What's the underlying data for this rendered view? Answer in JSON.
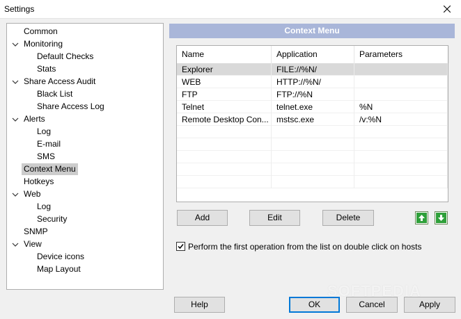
{
  "window": {
    "title": "Settings"
  },
  "tree": {
    "items": [
      {
        "label": "Common",
        "level": 0,
        "expanded": null,
        "selected": false
      },
      {
        "label": "Monitoring",
        "level": 0,
        "expanded": true,
        "selected": false
      },
      {
        "label": "Default Checks",
        "level": 1,
        "expanded": null,
        "selected": false
      },
      {
        "label": "Stats",
        "level": 1,
        "expanded": null,
        "selected": false
      },
      {
        "label": "Share Access Audit",
        "level": 0,
        "expanded": true,
        "selected": false
      },
      {
        "label": "Black List",
        "level": 1,
        "expanded": null,
        "selected": false
      },
      {
        "label": "Share Access Log",
        "level": 1,
        "expanded": null,
        "selected": false
      },
      {
        "label": "Alerts",
        "level": 0,
        "expanded": true,
        "selected": false
      },
      {
        "label": "Log",
        "level": 1,
        "expanded": null,
        "selected": false
      },
      {
        "label": "E-mail",
        "level": 1,
        "expanded": null,
        "selected": false
      },
      {
        "label": "SMS",
        "level": 1,
        "expanded": null,
        "selected": false
      },
      {
        "label": "Context Menu",
        "level": 0,
        "expanded": null,
        "selected": true
      },
      {
        "label": "Hotkeys",
        "level": 0,
        "expanded": null,
        "selected": false
      },
      {
        "label": "Web",
        "level": 0,
        "expanded": true,
        "selected": false
      },
      {
        "label": "Log",
        "level": 1,
        "expanded": null,
        "selected": false
      },
      {
        "label": "Security",
        "level": 1,
        "expanded": null,
        "selected": false
      },
      {
        "label": "SNMP",
        "level": 0,
        "expanded": null,
        "selected": false
      },
      {
        "label": "View",
        "level": 0,
        "expanded": true,
        "selected": false
      },
      {
        "label": "Device icons",
        "level": 1,
        "expanded": null,
        "selected": false
      },
      {
        "label": "Map Layout",
        "level": 1,
        "expanded": null,
        "selected": false
      }
    ]
  },
  "section": {
    "title": "Context Menu"
  },
  "list": {
    "columns": [
      "Name",
      "Application",
      "Parameters"
    ],
    "rows": [
      {
        "name": "Explorer",
        "application": "FILE://%N/",
        "parameters": "",
        "selected": true
      },
      {
        "name": "WEB",
        "application": "HTTP://%N/",
        "parameters": "",
        "selected": false
      },
      {
        "name": "FTP",
        "application": "FTP://%N",
        "parameters": "",
        "selected": false
      },
      {
        "name": "Telnet",
        "application": "telnet.exe",
        "parameters": "%N",
        "selected": false
      },
      {
        "name": "Remote Desktop Con...",
        "application": "mstsc.exe",
        "parameters": "/v:%N",
        "selected": false
      }
    ]
  },
  "actions": {
    "add": "Add",
    "edit": "Edit",
    "delete": "Delete"
  },
  "option": {
    "label": "Perform the first operation from the list on double click on hosts",
    "checked": true
  },
  "footer": {
    "help": "Help",
    "ok": "OK",
    "cancel": "Cancel",
    "apply": "Apply"
  },
  "watermark": "SOFTPEDIA",
  "colors": {
    "section_header": "#a9b6d9",
    "selection": "#cccccc",
    "arrow_green": "#2fa03a",
    "default_button_border": "#0078d7"
  }
}
